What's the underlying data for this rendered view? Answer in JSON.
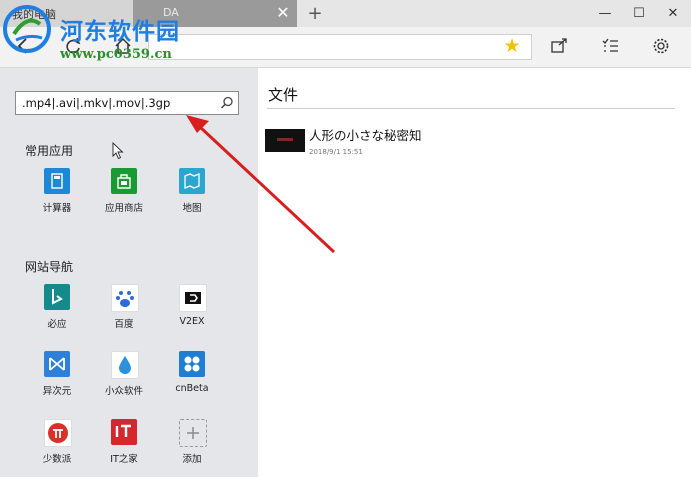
{
  "tabs": [
    {
      "title": "我的电脑"
    },
    {
      "title": "DA",
      "close": "✕"
    }
  ],
  "window_controls": {
    "minimize": "—",
    "maximize": "☐",
    "close": "✕"
  },
  "navbar": {
    "crumb": "DA",
    "star_icon": "star-icon",
    "tools": [
      "share-icon",
      "list-icon",
      "gear-icon"
    ]
  },
  "watermark": {
    "brand": "河东软件园",
    "url": "www.pc0359.cn"
  },
  "search": {
    "value": ".mp4|.avi|.mkv|.mov|.3gp"
  },
  "sections": {
    "common_apps": {
      "title": "常用应用",
      "items": [
        {
          "label": "计算器",
          "icon": "calculator-icon",
          "color": "#1e88d8"
        },
        {
          "label": "应用商店",
          "icon": "store-icon",
          "color": "#1a9a32"
        },
        {
          "label": "地图",
          "icon": "map-icon",
          "color": "#2aa6cf"
        }
      ]
    },
    "site_nav": {
      "title": "网站导航",
      "items": [
        {
          "label": "必应",
          "icon": "bing-icon",
          "color": "#158a8a"
        },
        {
          "label": "百度",
          "icon": "baidu-icon",
          "color": "#2f6ad8"
        },
        {
          "label": "V2EX",
          "icon": "v2ex-icon",
          "color": "#ffffff"
        },
        {
          "label": "异次元",
          "icon": "iplaysoft-icon",
          "color": "#2f80d8"
        },
        {
          "label": "小众软件",
          "icon": "appinn-icon",
          "color": "#2b90de"
        },
        {
          "label": "cnBeta",
          "icon": "cnbeta-icon",
          "color": "#1f7ed0"
        },
        {
          "label": "少数派",
          "icon": "sspai-icon",
          "color": "#d8312a"
        },
        {
          "label": "IT之家",
          "icon": "ithome-icon",
          "color": "#d4282e"
        },
        {
          "label": "添加",
          "icon": "add-icon",
          "color": "#9a9a9a"
        }
      ]
    }
  },
  "content": {
    "title": "文件",
    "files": [
      {
        "name": "人形の小さな秘密知",
        "date": "2018/9/1 15:51"
      }
    ]
  },
  "colors": {
    "annotation_arrow": "#d81f1f"
  }
}
